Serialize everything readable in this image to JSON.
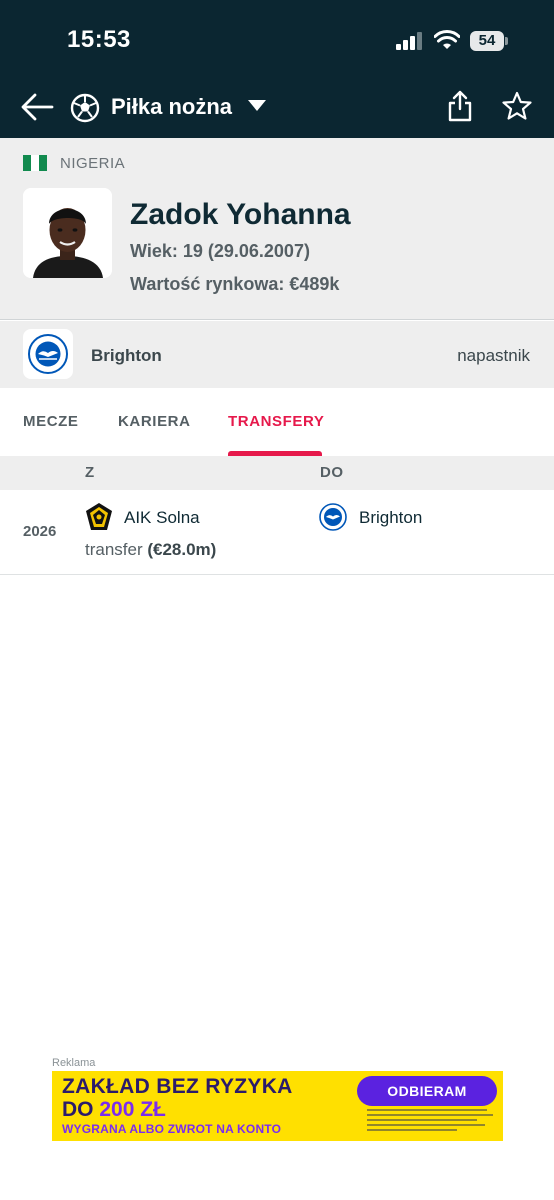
{
  "status_bar": {
    "time": "15:53",
    "battery": "54"
  },
  "app_bar": {
    "sport": "Piłka nożna"
  },
  "player": {
    "country": "NIGERIA",
    "name": "Zadok Yohanna",
    "age": "Wiek: 19 (29.06.2007)",
    "market_value": "Wartość rynkowa: €489k",
    "team": "Brighton",
    "position": "napastnik"
  },
  "tabs": [
    {
      "label": "MECZE",
      "active": false
    },
    {
      "label": "KARIERA",
      "active": false
    },
    {
      "label": "TRANSFERY",
      "active": true
    }
  ],
  "transfers": {
    "headers": {
      "from": "Z",
      "to": "DO"
    },
    "rows": [
      {
        "year": "2026",
        "from": "AIK Solna",
        "to": "Brighton",
        "type": "transfer",
        "fee": "(€28.0m)"
      }
    ]
  },
  "ad": {
    "label": "Reklama",
    "line1": "ZAKŁAD BEZ RYZYKA",
    "line2_prefix": "DO ",
    "line2_amount": "200 ZŁ",
    "line3": "WYGRANA ALBO ZWROT NA KONTO",
    "cta": "ODBIERAM"
  },
  "colors": {
    "header_bg": "#0b2631",
    "accent": "#e6194b",
    "nigeria_green": "#118a4e",
    "brighton_blue": "#0057b8",
    "ad_yellow": "#ffe000",
    "ad_purple": "#5b22e0"
  },
  "icons": [
    "back-arrow-icon",
    "soccer-ball-icon",
    "caret-down-icon",
    "share-icon",
    "star-icon",
    "nigeria-flag-icon",
    "brighton-logo-icon",
    "aik-logo-icon"
  ]
}
